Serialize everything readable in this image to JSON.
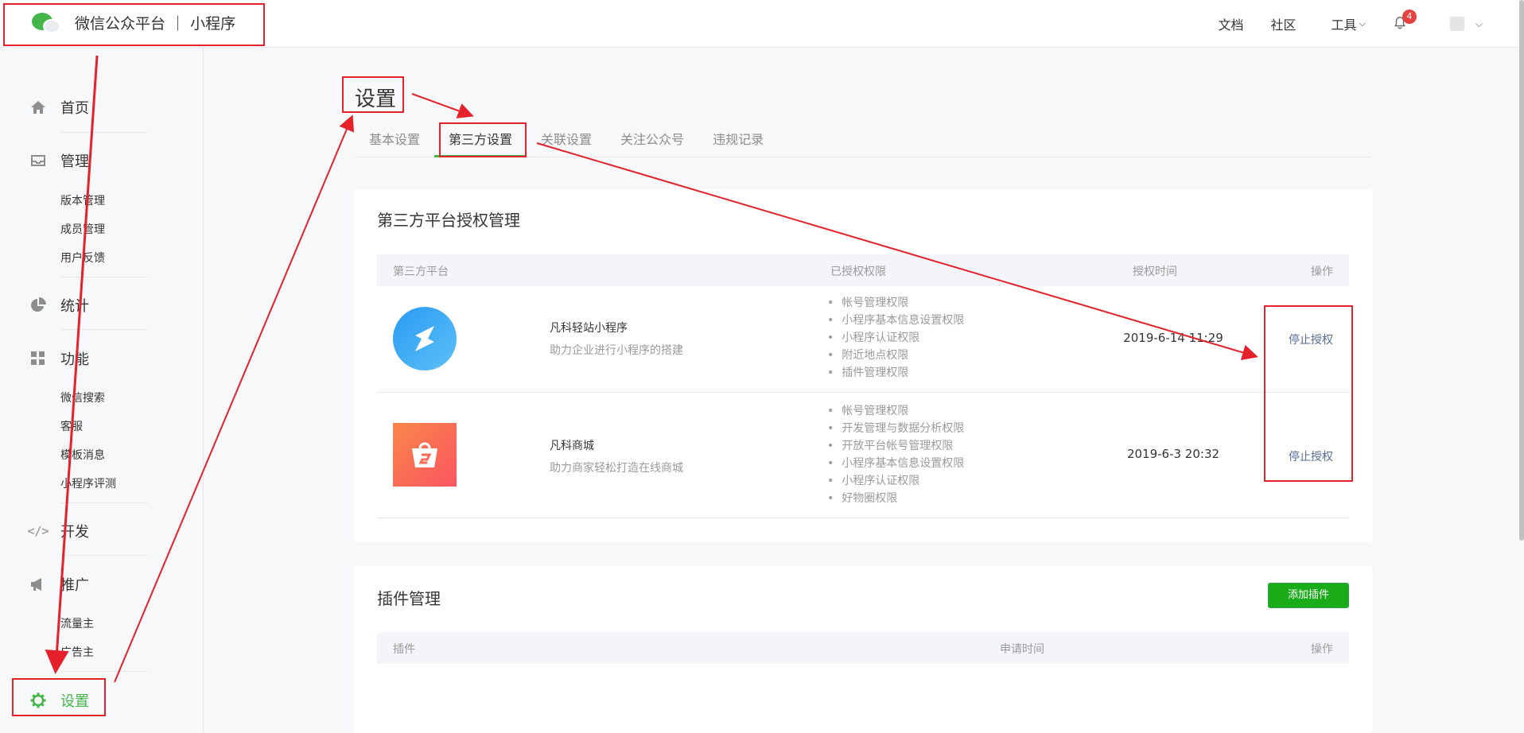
{
  "header": {
    "title": "微信公众平台 ｜ 小程序",
    "links": [
      "文档",
      "社区"
    ],
    "tools_label": "工具",
    "notification_count": "4"
  },
  "sidebar": {
    "home": "首页",
    "manage": "管理",
    "manage_items": [
      "版本管理",
      "成员管理",
      "用户反馈"
    ],
    "stats": "统计",
    "features": "功能",
    "feature_items": [
      "微信搜索",
      "客服",
      "模板消息",
      "小程序评测"
    ],
    "develop": "开发",
    "promote": "推广",
    "promote_items": [
      "流量主",
      "广告主"
    ],
    "settings": "设置"
  },
  "main": {
    "page_title": "设置",
    "tabs": [
      "基本设置",
      "第三方设置",
      "关联设置",
      "关注公众号",
      "违规记录"
    ],
    "active_tab": "第三方设置",
    "third_party": {
      "title": "第三方平台授权管理",
      "columns": [
        "第三方平台",
        "已授权权限",
        "授权时间",
        "操作"
      ],
      "rows": [
        {
          "name": "凡科轻站小程序",
          "desc": "助力企业进行小程序的搭建",
          "perms": [
            "帐号管理权限",
            "小程序基本信息设置权限",
            "小程序认证权限",
            "附近地点权限",
            "插件管理权限"
          ],
          "time": "2019-6-14 11:29",
          "action": "停止授权"
        },
        {
          "name": "凡科商城",
          "desc": "助力商家轻松打造在线商城",
          "perms": [
            "帐号管理权限",
            "开发管理与数据分析权限",
            "开放平台帐号管理权限",
            "小程序基本信息设置权限",
            "小程序认证权限",
            "好物圈权限"
          ],
          "time": "2019-6-3 20:32",
          "action": "停止授权"
        }
      ]
    },
    "plugins": {
      "title": "插件管理",
      "add_button": "添加插件",
      "columns": [
        "插件",
        "申请时间",
        "操作"
      ]
    }
  },
  "colors": {
    "accent": "#44b549",
    "annotation": "#e5212b",
    "link": "#576b95"
  }
}
